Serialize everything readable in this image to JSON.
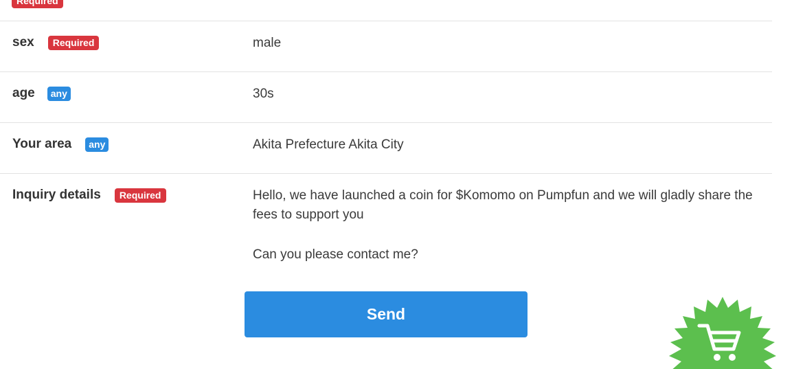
{
  "form": {
    "top_badge": "Required",
    "rows": [
      {
        "label": "sex",
        "badge": "Required",
        "badge_type": "required",
        "value": "male"
      },
      {
        "label": "age",
        "badge": "any",
        "badge_type": "any",
        "value": "30s"
      },
      {
        "label": "Your area",
        "badge": "any",
        "badge_type": "any",
        "value": "Akita Prefecture Akita City"
      },
      {
        "label": "Inquiry details",
        "badge": "Required",
        "badge_type": "required",
        "value_line1": "Hello, we have launched a coin for $Komomo on Pumpfun and we will gladly share the fees to support you",
        "value_line2": "Can you please contact me?"
      }
    ],
    "send_label": "Send"
  },
  "floating_cart": {
    "icon": "shopping-cart-icon",
    "color": "#5cbf4e"
  },
  "colors": {
    "required": "#d9363e",
    "any": "#2b8ce0",
    "button": "#2b8ce0"
  }
}
